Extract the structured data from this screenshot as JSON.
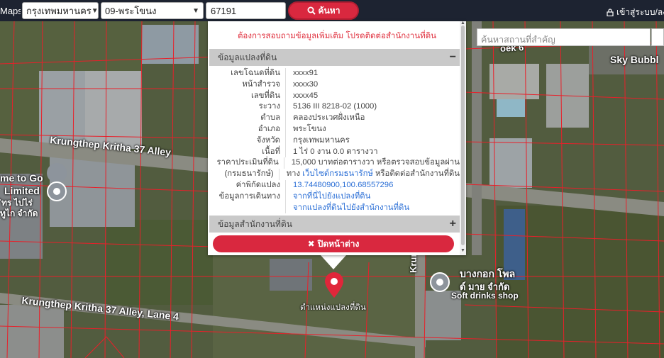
{
  "topbar": {
    "brand": "Maps",
    "province": "กรุงเทพมหานคร",
    "district": "09-พระโขนง",
    "parcel_no": "67191",
    "search_label": "ค้นหา",
    "login_label": "เข้าสู่ระบบ/ลงท"
  },
  "map": {
    "place_search_placeholder": "ค้นหาสถานที่สำคัญ",
    "labels": {
      "street1": "Krungthep Kritha 37 Alley",
      "street2": "Krungthep Kritha 37 Alley, Lane 4",
      "street3": "Krung",
      "soi": "oek 6",
      "sky": "Sky Bubbl",
      "left_poi_1": "me to Go",
      "left_poi_2": "Limited",
      "left_poi_3": "ิทร ไปไร่",
      "left_poi_4": "ทูไก จำกัด",
      "right_poi_1": "บางกอก โพล",
      "right_poi_2": "ด์ มาย จำกัด",
      "right_poi_3": "Soft drinks shop",
      "marker_label": "ตำแหน่งแปลงที่ดิน"
    }
  },
  "popup": {
    "notice": "ต้องการสอบถามข้อมูลเพิ่มเติม โปรดติดต่อสำนักงานที่ดิน",
    "section1_title": "ข้อมูลแปลงที่ดิน",
    "section1_toggle": "−",
    "rows": [
      {
        "k": "เลขโฉนดที่ดิน",
        "v": "xxxx91"
      },
      {
        "k": "หน้าสำรวจ",
        "v": "xxxx30"
      },
      {
        "k": "เลขที่ดิน",
        "v": "xxxx45"
      },
      {
        "k": "ระวาง",
        "v": "5136 III 8218-02 (1000)"
      },
      {
        "k": "ตำบล",
        "v": "คลองประเวศฝั่งเหนือ"
      },
      {
        "k": "อำเภอ",
        "v": "พระโขนง"
      },
      {
        "k": "จังหวัด",
        "v": "กรุงเทพมหานคร"
      },
      {
        "k": "เนื้อที่",
        "v": "1 ไร่ 0 งาน 0.0 ตารางวา"
      },
      {
        "k": "ราคาประเมินที่ดิน",
        "v": "15,000 บาทต่อตารางวา หรือตรวจสอบข้อมูลผ่าน"
      }
    ],
    "row_dept_key": "(กรมธนารักษ์)",
    "row_dept_prefix": "ทาง",
    "row_dept_link": "เว็บไซต์กรมธนารักษ์",
    "row_dept_suffix": "หรือติดต่อสำนักงานที่ดิน",
    "coord_key": "ค่าพิกัดแปลง",
    "coord_value": "13.74480900,100.68557296",
    "travel_key": "ข้อมูลการเดินทาง",
    "travel_link1": "จากที่นี่ไปยังแปลงที่ดิน",
    "travel_link2": "จากแปลงที่ดินไปยังสำนักงานที่ดิน",
    "section2_title": "ข้อมูลสำนักงานที่ดิน",
    "section2_toggle": "+",
    "close_label": "ปิดหน้าต่าง"
  },
  "colors": {
    "topbar": "#1d2331",
    "accent_red": "#d9283f",
    "parcel_line": "#e8202a",
    "link_blue": "#2b6fd6"
  }
}
